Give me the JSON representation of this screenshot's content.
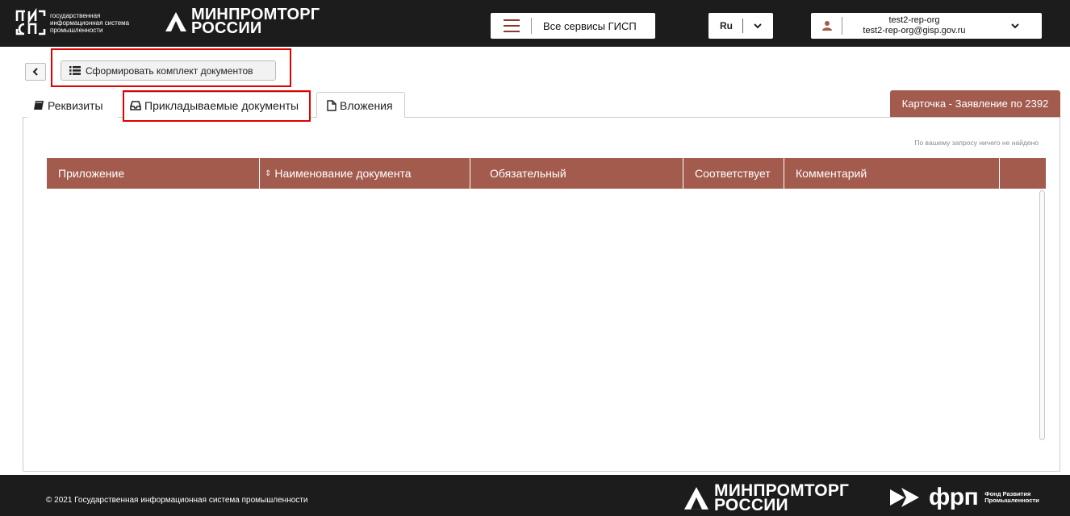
{
  "header": {
    "gis_logo_lines": [
      "государственная",
      "информационная система",
      "промышленности"
    ],
    "ministry_logo_lines": [
      "МИНПРОМТОРГ",
      "РОССИИ"
    ],
    "services_label": "Все сервисы ГИСП",
    "language": "Ru",
    "user_name": "test2-rep-org",
    "user_email": "test2-rep-org@gisp.gov.ru"
  },
  "toolbar": {
    "back_icon": "chevron-left-icon",
    "form_button_label": "Сформировать комплект документов",
    "form_button_icon": "list-icon"
  },
  "tabs": [
    {
      "label": "Реквизиты",
      "icon": "book-icon",
      "active": false
    },
    {
      "label": "Прикладываемые документы",
      "icon": "inbox-icon",
      "active": true
    },
    {
      "label": "Вложения",
      "icon": "file-icon",
      "active": false
    }
  ],
  "card_label": "Карточка - Заявление по 2392",
  "table": {
    "empty_message": "По вашему запросу ничего не найдено",
    "columns": [
      "Приложение",
      "Наименование документа",
      "Обязательный",
      "Соответствует",
      "Комментарий",
      ""
    ],
    "rows": []
  },
  "footer": {
    "copyright": "© 2021 Государственная информационная система промышленности",
    "ministry_logo_lines": [
      "МИНПРОМТОРГ",
      "РОССИИ"
    ],
    "frp_name": "фрп",
    "frp_sub_lines": [
      "Фонд Развития",
      "Промышленности"
    ]
  },
  "colors": {
    "accent": "#a35b4e",
    "header_bg": "#1c1c1c",
    "highlight": "#e00000"
  }
}
